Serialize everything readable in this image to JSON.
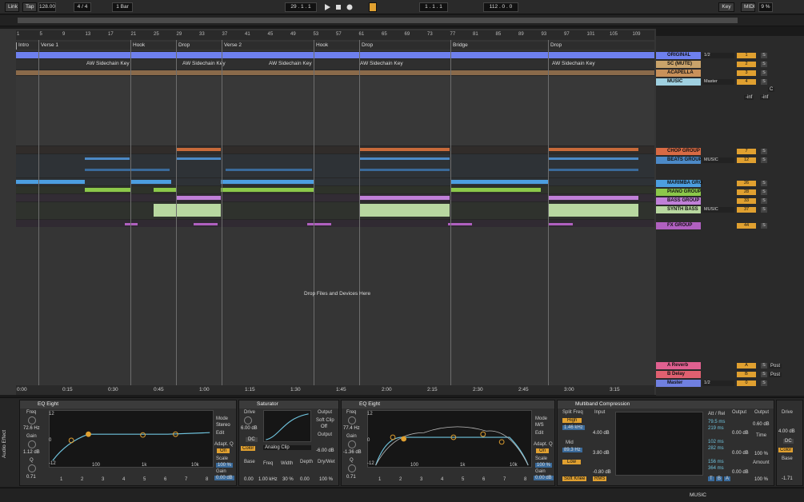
{
  "transport": {
    "link": "Link",
    "tap": "Tap",
    "tempo": "128.00",
    "signature": "4 / 4",
    "quantize": "1 Bar",
    "position": "29 .  1 .  1",
    "loop_start": "1 .  1 .  1",
    "loop_length": "112 .  0 .  0",
    "key": "Key",
    "midi": "MIDI",
    "cpu": "9 %"
  },
  "ruler": {
    "bars": [
      "1",
      "5",
      "9",
      "13",
      "17",
      "21",
      "25",
      "29",
      "33",
      "37",
      "41",
      "45",
      "49",
      "53",
      "57",
      "61",
      "65",
      "69",
      "73",
      "77",
      "81",
      "85",
      "89",
      "93",
      "97",
      "101",
      "105",
      "109"
    ]
  },
  "locators": [
    "Intro",
    "Verse 1",
    "Hook",
    "Drop",
    "Verse 2",
    "Hook",
    "Drop",
    "Bridge",
    "Drop"
  ],
  "sidechain_label": "AW Sidechain Key",
  "drop_text": "Drop Files and Devices Here",
  "timeline": [
    "0:00",
    "0:15",
    "0:30",
    "0:45",
    "1:00",
    "1:15",
    "1:30",
    "1:45",
    "2:00",
    "2:15",
    "2:30",
    "2:45",
    "3:00",
    "3:15"
  ],
  "tracks": [
    {
      "name": "ORIGINAL",
      "num": "1",
      "route": "1/2",
      "color": "#6e80ee"
    },
    {
      "name": "SC (MUTE)",
      "num": "2",
      "route": "",
      "color": "#c9a36a"
    },
    {
      "name": "ACAPELLA",
      "num": "3",
      "route": "",
      "color": "#c9915a"
    },
    {
      "name": "MUSIC",
      "num": "4",
      "route": "Master",
      "color": "#9fd0e0"
    },
    {
      "name": "CHOP GROUP",
      "num": "7",
      "route": "",
      "color": "#d86a44"
    },
    {
      "name": "BEATS GROUP",
      "num": "12",
      "route": "MUSIC",
      "color": "#4c89c6"
    },
    {
      "name": "MARIMBA GRO",
      "num": "26",
      "route": "",
      "color": "#4c9ee0"
    },
    {
      "name": "PIANO GROUP",
      "num": "28",
      "route": "",
      "color": "#8cc84a"
    },
    {
      "name": "BASS GROUP",
      "num": "33",
      "route": "",
      "color": "#c080d8"
    },
    {
      "name": "SYNTH BASS",
      "num": "37",
      "route": "MUSIC",
      "color": "#b8d8a0"
    },
    {
      "name": "FX GROUP",
      "num": "44",
      "route": "",
      "color": "#b060c0"
    },
    {
      "name": "A Reverb",
      "num": "A",
      "route": "",
      "color": "#e06090"
    },
    {
      "name": "B Delay",
      "num": "B",
      "route": "",
      "color": "#e06070"
    },
    {
      "name": "Master",
      "num": "0",
      "route": "1/2",
      "color": "#7080e0"
    }
  ],
  "mixer_misc": {
    "inf1": "-inf",
    "inf2": "-inf",
    "c": "C",
    "post": "Post",
    "s": "S"
  },
  "devices": {
    "rack_label": "Audio Effect",
    "eq1": {
      "title": "EQ Eight",
      "freq_label": "Freq",
      "freq": "72.6 Hz",
      "gain_label": "Gain",
      "gain": "1.12 dB",
      "q_label": "Q",
      "q": "0.71",
      "mode_label": "Mode",
      "mode": "Stereo",
      "edit_label": "Edit",
      "adapt_label": "Adapt. Q",
      "adapt": "On",
      "scale_label": "Scale",
      "scale": "100 %",
      "out_gain_label": "Gain",
      "out_gain": "0.00 dB",
      "db_ticks": [
        "12",
        "6",
        "0",
        "-6",
        "-12"
      ],
      "freq_ticks": [
        "100",
        "1k",
        "10k"
      ],
      "bands": [
        "1",
        "2",
        "3",
        "4",
        "5",
        "6",
        "7",
        "8"
      ]
    },
    "saturator": {
      "title": "Saturator",
      "drive_label": "Drive",
      "drive": "6.00 dB",
      "dc_label": "DC",
      "color_label": "Color",
      "type": "Analog Clip",
      "output_label": "Output",
      "softclip_label": "Soft Clip",
      "softclip": "Off",
      "output_val": "-6.00 dB",
      "base_label": "Base",
      "base": "0.00",
      "freq_label": "Freq",
      "freq": "1.00 kHz",
      "width_label": "Width",
      "width": "30 %",
      "depth_label": "Depth",
      "depth": "0.00",
      "drywet_label": "Dry/Wet",
      "drywet": "100 %"
    },
    "eq2": {
      "title": "EQ Eight",
      "freq_label": "Freq",
      "freq": "77.4 Hz",
      "gain_label": "Gain",
      "gain": "-1.36 dB",
      "q_label": "Q",
      "q": "0.71",
      "mode_label": "Mode",
      "mode": "M/S",
      "edit_label": "Edit",
      "adapt_label": "Adapt. Q",
      "adapt": "On",
      "scale_label": "Scale",
      "scale": "100 %",
      "out_gain_label": "Gain",
      "out_gain": "0.00 dB",
      "db_ticks": [
        "12",
        "6",
        "0",
        "-6",
        "-12"
      ],
      "freq_ticks": [
        "100",
        "1k",
        "10k"
      ],
      "bands": [
        "1",
        "2",
        "3",
        "4",
        "5",
        "6",
        "7",
        "8"
      ]
    },
    "multiband": {
      "title": "Multiband Compression",
      "split_label": "Split Freq",
      "high_label": "High",
      "high_freq": "1.46 kHz",
      "mid_label": "Mid",
      "mid_freq": "89.3 Hz",
      "low_label": "Low",
      "softknee": "Soft Knee",
      "rms": "RMS",
      "input_label": "Input",
      "in_high": "4.00 dB",
      "in_mid": "3.80 dB",
      "in_low": "-0.80 dB",
      "att_label": "Att / Rel",
      "att_high_a": "79.5 ms",
      "att_high_r": "219 ms",
      "att_mid_a": "102 ms",
      "att_mid_r": "282 ms",
      "att_low_a": "156 ms",
      "att_low_r": "364 ms",
      "output_label": "Output",
      "out1": "0.00 dB",
      "out2": "0.00 dB",
      "out3": "0.00 dB",
      "output2_label": "Output",
      "output2": "0.60 dB",
      "time_label": "Time",
      "time": "100 %",
      "amount_label": "Amount",
      "amount": "100 %",
      "scale_ticks": [
        "60",
        "70",
        "60",
        "50",
        "40",
        "30",
        "20",
        "10",
        "0"
      ],
      "t_label": "T",
      "b_label": "B",
      "a_label": "A"
    },
    "drive": {
      "drive_label": "Drive",
      "drive": "4.00 dB",
      "dc_label": "DC",
      "color_label": "Color",
      "base_label": "Base",
      "base": "-1.71"
    }
  },
  "status": {
    "track": "MUSIC"
  }
}
